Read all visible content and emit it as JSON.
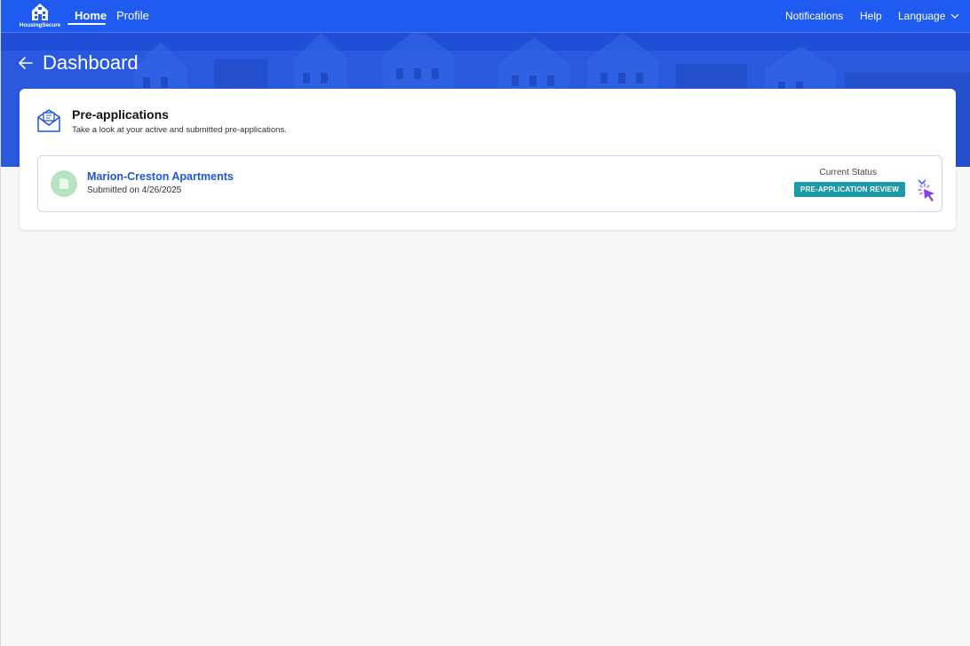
{
  "nav": {
    "logo_text": "HousingSecure",
    "home": "Home",
    "profile": "Profile",
    "notifications": "Notifications",
    "help": "Help",
    "language": "Language"
  },
  "hero": {
    "title": "Dashboard"
  },
  "preapplications": {
    "title": "Pre-applications",
    "subtitle": "Take a look at your active and submitted pre-applications.",
    "items": [
      {
        "name": "Marion-Creston Apartments",
        "submitted": "Submitted on 4/26/2025",
        "status_label": "Current Status",
        "status": "PRE-APPLICATION REVIEW"
      }
    ]
  },
  "colors": {
    "brand_blue": "#1f5bf0",
    "status_teal": "#1a9ba6",
    "link_blue": "#1e57d9",
    "avatar_green": "#b7e3c2"
  },
  "icons": {
    "logo": "house-building-icon",
    "back": "arrow-left-icon",
    "card": "envelope-open-icon",
    "avatar": "document-icon",
    "expand": "chevron-down-icon",
    "cursor": "pointer-cursor-icon",
    "language_dropdown": "chevron-down-icon"
  }
}
